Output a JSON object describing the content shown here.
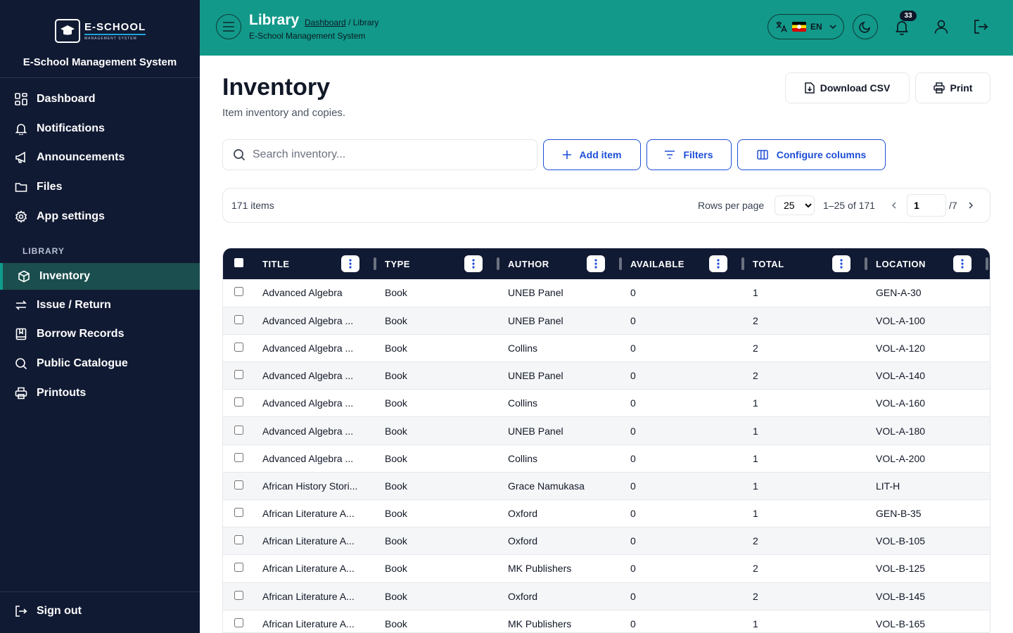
{
  "brand": {
    "logo_main": "E-SCHOOL",
    "logo_sub": "MANAGEMENT SYSTEM",
    "name": "E-School Management System"
  },
  "sidebar": {
    "items": [
      {
        "label": "Dashboard",
        "icon": "grid-icon"
      },
      {
        "label": "Notifications",
        "icon": "bell-icon"
      },
      {
        "label": "Announcements",
        "icon": "megaphone-icon"
      },
      {
        "label": "Files",
        "icon": "folder-icon"
      },
      {
        "label": "App settings",
        "icon": "gear-icon"
      }
    ],
    "section_label": "LIBRARY",
    "library_items": [
      {
        "label": "Inventory",
        "icon": "package-icon",
        "active": true
      },
      {
        "label": "Issue / Return",
        "icon": "arrows-icon"
      },
      {
        "label": "Borrow Records",
        "icon": "bookmark-book-icon"
      },
      {
        "label": "Public Catalogue",
        "icon": "search-icon"
      },
      {
        "label": "Printouts",
        "icon": "printer-icon"
      }
    ],
    "sign_out": "Sign out"
  },
  "header": {
    "title": "Library",
    "crumb_link": "Dashboard",
    "crumb_current": "/ Library",
    "subtitle": "E-School Management System",
    "language": "EN",
    "notification_count": "33"
  },
  "main": {
    "title": "Inventory",
    "subtitle": "Item inventory and copies.",
    "download_label": "Download CSV",
    "print_label": "Print",
    "search_placeholder": "Search inventory...",
    "add_label": "Add item",
    "filters_label": "Filters",
    "configure_label": "Configure columns"
  },
  "pager": {
    "count": "171 items",
    "rows_label": "Rows per page",
    "rows_value": "25",
    "range": "1–25 of 171",
    "page": "1",
    "total_pages": "/7"
  },
  "table": {
    "columns": [
      "TITLE",
      "TYPE",
      "AUTHOR",
      "AVAILABLE",
      "TOTAL",
      "LOCATION"
    ],
    "rows": [
      [
        "Advanced Algebra",
        "Book",
        "UNEB Panel",
        "0",
        "1",
        "GEN-A-30"
      ],
      [
        "Advanced Algebra ...",
        "Book",
        "UNEB Panel",
        "0",
        "2",
        "VOL-A-100"
      ],
      [
        "Advanced Algebra ...",
        "Book",
        "Collins",
        "0",
        "2",
        "VOL-A-120"
      ],
      [
        "Advanced Algebra ...",
        "Book",
        "UNEB Panel",
        "0",
        "2",
        "VOL-A-140"
      ],
      [
        "Advanced Algebra ...",
        "Book",
        "Collins",
        "0",
        "1",
        "VOL-A-160"
      ],
      [
        "Advanced Algebra ...",
        "Book",
        "UNEB Panel",
        "0",
        "1",
        "VOL-A-180"
      ],
      [
        "Advanced Algebra ...",
        "Book",
        "Collins",
        "0",
        "1",
        "VOL-A-200"
      ],
      [
        "African History Stori...",
        "Book",
        "Grace Namukasa",
        "0",
        "1",
        "LIT-H"
      ],
      [
        "African Literature A...",
        "Book",
        "Oxford",
        "0",
        "1",
        "GEN-B-35"
      ],
      [
        "African Literature A...",
        "Book",
        "Oxford",
        "0",
        "2",
        "VOL-B-105"
      ],
      [
        "African Literature A...",
        "Book",
        "MK Publishers",
        "0",
        "2",
        "VOL-B-125"
      ],
      [
        "African Literature A...",
        "Book",
        "Oxford",
        "0",
        "2",
        "VOL-B-145"
      ],
      [
        "African Literature A...",
        "Book",
        "MK Publishers",
        "0",
        "1",
        "VOL-B-165"
      ]
    ]
  },
  "colors": {
    "sidebar_bg": "#111a33",
    "header_bg": "#12998a",
    "accent_blue": "#1d4ed8",
    "active_item": "#1b4e4e"
  }
}
